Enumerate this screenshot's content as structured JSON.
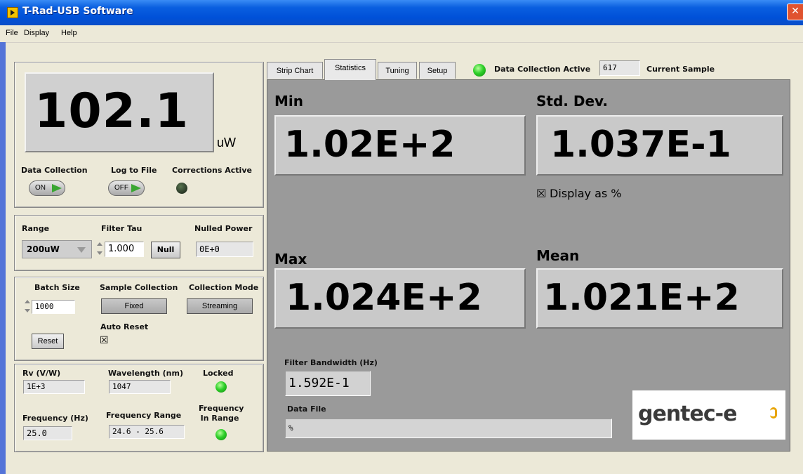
{
  "window": {
    "title": "T-Rad-USB Software"
  },
  "menu": [
    "File",
    "Display",
    "Help"
  ],
  "display": {
    "value": "102.1",
    "unit": "uW"
  },
  "controls": {
    "data_collection_label": "Data Collection",
    "data_collection_state": "ON",
    "log_to_file_label": "Log to File",
    "log_to_file_state": "OFF",
    "corrections_label": "Corrections Active"
  },
  "range_panel": {
    "range_label": "Range",
    "range_value": "200uW",
    "filter_tau_label": "Filter Tau",
    "filter_tau_value": "1.000",
    "null_button": "Null",
    "nulled_power_label": "Nulled Power",
    "nulled_power_value": "0E+0"
  },
  "batch_panel": {
    "batch_size_label": "Batch Size",
    "batch_size_value": "1000",
    "sample_collection_label": "Sample Collection",
    "sample_collection_value": "Fixed",
    "collection_mode_label": "Collection Mode",
    "collection_mode_value": "Streaming",
    "auto_reset_label": "Auto Reset",
    "reset_button": "Reset",
    "auto_reset_checked": "☒"
  },
  "sensor_panel": {
    "rv_label": "Rv (V/W)",
    "rv_value": "1E+3",
    "wavelength_label": "Wavelength (nm)",
    "wavelength_value": "1047",
    "locked_label": "Locked",
    "frequency_label": "Frequency (Hz)",
    "frequency_value": "25.0",
    "frequency_range_label": "Frequency Range",
    "frequency_range_value": "24.6 - 25.6",
    "in_range_label_1": "Frequency",
    "in_range_label_2": "In Range"
  },
  "tabs": [
    "Strip Chart",
    "Statistics",
    "Tuning",
    "Setup"
  ],
  "status": {
    "data_collection_active_label": "Data Collection Active",
    "current_sample_value": "617",
    "current_sample_label": "Current Sample"
  },
  "statistics": {
    "min_label": "Min",
    "min_value": "1.02E+2",
    "std_label": "Std. Dev.",
    "std_value": "1.037E-1",
    "display_percent_label": "Display as %",
    "display_percent_checked": "☒",
    "max_label": "Max",
    "max_value": "1.024E+2",
    "mean_label": "Mean",
    "mean_value": "1.021E+2",
    "filter_bw_label": "Filter Bandwidth (Hz)",
    "filter_bw_value": "1.592E-1",
    "data_file_label": "Data File",
    "data_file_value": "%"
  },
  "logo": {
    "text_main": "gentec-e",
    "text_o": "o"
  },
  "colors": {
    "led_on": "#2fd02a",
    "led_off": "#2f3f2c",
    "panel_bg": "#9a9a9a",
    "title_bar": "#0050d8"
  }
}
